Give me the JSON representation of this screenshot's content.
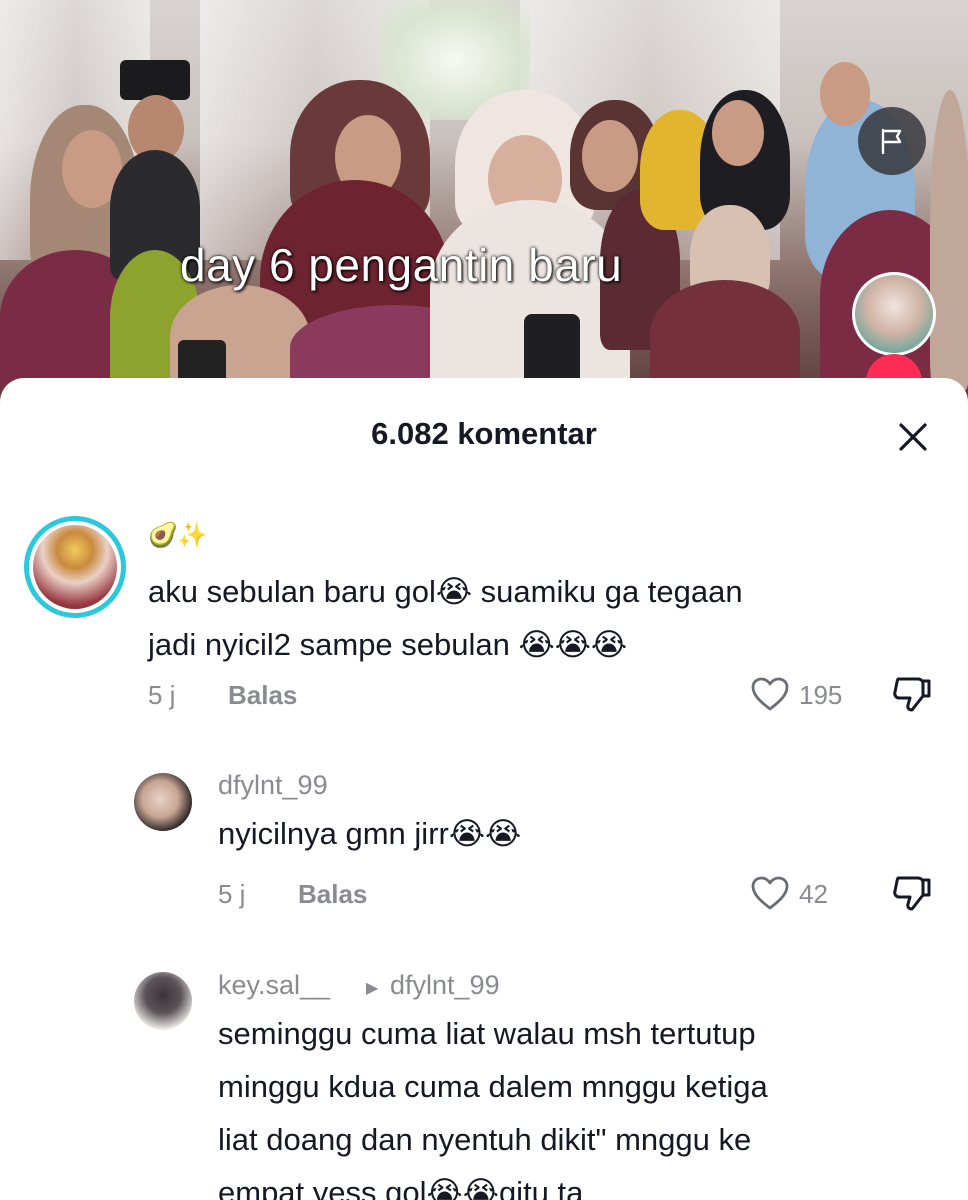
{
  "video": {
    "overlay_text": "day 6 pengantin baru",
    "flag_icon": "flag-icon"
  },
  "sheet": {
    "title": "6.082 komentar",
    "close_icon": "close-icon"
  },
  "comments": [
    {
      "username_emoji": "🥑✨",
      "text_line1": "aku sebulan baru gol😭 suamiku ga tegaan",
      "text_line2": "jadi nyicil2 sampe sebulan 😭😭😭",
      "time": "5 j",
      "reply_label": "Balas",
      "likes": "195"
    },
    {
      "username": "dfylnt_99",
      "text_line1": "nyicilnya gmn jirr😭😭",
      "time": "5 j",
      "reply_label": "Balas",
      "likes": "42"
    },
    {
      "username": "key.sal__",
      "reply_to": "dfylnt_99",
      "text_line1": "seminggu cuma liat walau msh tertutup",
      "text_line2": "minggu kdua cuma dalem mnggu ketiga",
      "text_line3": "liat doang dan nyentuh dikit\" mnggu ke",
      "text_line4": "empat yess gol😭😭gitu ta"
    }
  ]
}
